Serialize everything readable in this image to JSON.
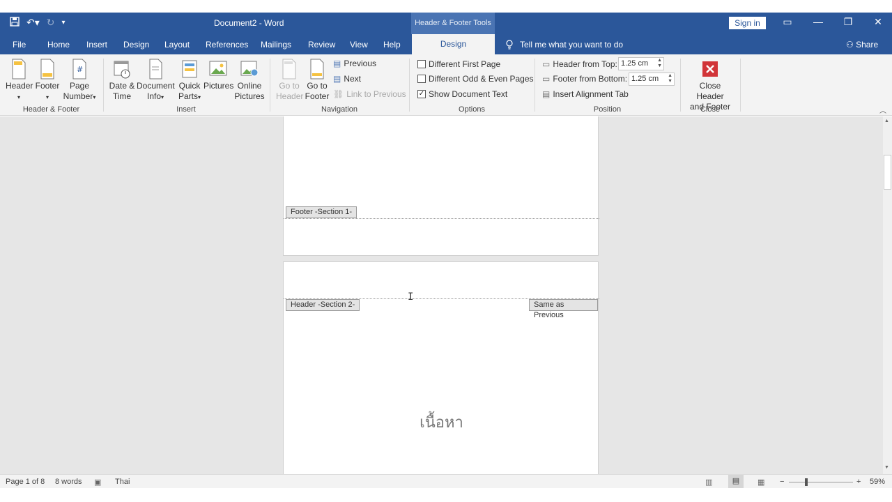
{
  "titlebar": {
    "doc_title": "Document2  -  Word",
    "contextual": "Header & Footer Tools",
    "sign_in": "Sign in"
  },
  "tabs": {
    "file": "File",
    "home": "Home",
    "insert": "Insert",
    "design": "Design",
    "layout": "Layout",
    "references": "References",
    "mailings": "Mailings",
    "review": "Review",
    "view": "View",
    "help": "Help",
    "design_active": "Design",
    "tell_me": "Tell me what you want to do",
    "share": "Share"
  },
  "ribbon": {
    "header_footer": {
      "header": "Header",
      "footer": "Footer",
      "page_number_1": "Page",
      "page_number_2": "Number",
      "label": "Header & Footer"
    },
    "insert": {
      "date_time_1": "Date &",
      "date_time_2": "Time",
      "doc_info_1": "Document",
      "doc_info_2": "Info",
      "quick_parts_1": "Quick",
      "quick_parts_2": "Parts",
      "pictures": "Pictures",
      "online_pictures_1": "Online",
      "online_pictures_2": "Pictures",
      "label": "Insert"
    },
    "navigation": {
      "go_to_header_1": "Go to",
      "go_to_header_2": "Header",
      "go_to_footer_1": "Go to",
      "go_to_footer_2": "Footer",
      "previous": "Previous",
      "next": "Next",
      "link_to_previous": "Link to Previous",
      "label": "Navigation"
    },
    "options": {
      "different_first_page": "Different First Page",
      "different_odd_even": "Different Odd & Even Pages",
      "show_document_text": "Show Document Text",
      "label": "Options"
    },
    "position": {
      "header_from_top": "Header from Top:",
      "header_from_top_value": "1.25 cm",
      "footer_from_bottom": "Footer from Bottom:",
      "footer_from_bottom_value": "1.25 cm",
      "insert_alignment_tab": "Insert Alignment Tab",
      "label": "Position"
    },
    "close": {
      "close_1": "Close Header",
      "close_2": "and Footer",
      "label": "Close"
    }
  },
  "document": {
    "footer_tag": "Footer -Section 1-",
    "header_tag": "Header -Section 2-",
    "same_as_previous": "Same as Previous",
    "body_text": "เนื้อหา"
  },
  "status": {
    "page": "Page 1 of 8",
    "words": "8 words",
    "language": "Thai",
    "zoom": "59%"
  },
  "colors": {
    "brand": "#2b579a",
    "close_red": "#d13438"
  }
}
